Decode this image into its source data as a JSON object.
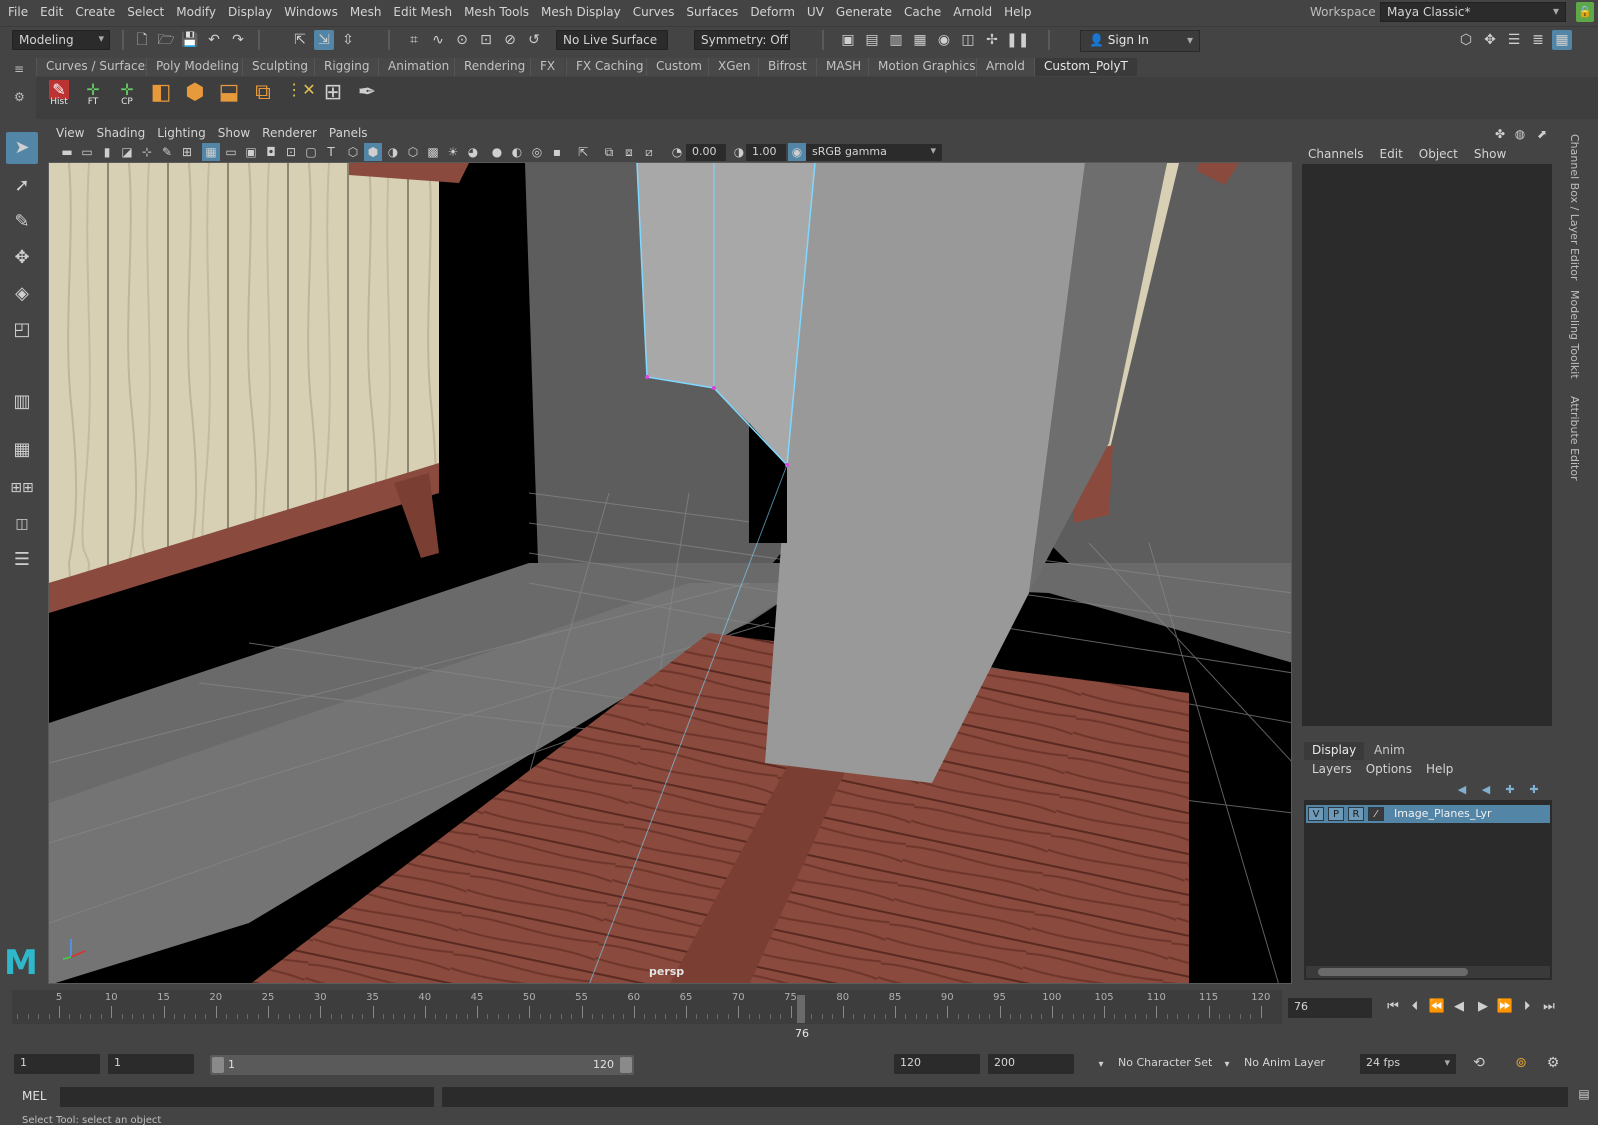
{
  "menu": [
    "File",
    "Edit",
    "Create",
    "Select",
    "Modify",
    "Display",
    "Windows",
    "Mesh",
    "Edit Mesh",
    "Mesh Tools",
    "Mesh Display",
    "Curves",
    "Surfaces",
    "Deform",
    "UV",
    "Generate",
    "Cache",
    "Arnold",
    "Help"
  ],
  "workspace": {
    "label": "Workspace :",
    "value": "Maya Classic*"
  },
  "status": {
    "menuset": "Modeling",
    "live_surface": "No Live Surface",
    "symmetry": "Symmetry: Off",
    "signin": "Sign In"
  },
  "shelf": {
    "tabs": [
      "Curves / Surfaces",
      "Poly Modeling",
      "Sculpting",
      "Rigging",
      "Animation",
      "Rendering",
      "FX",
      "FX Caching",
      "Custom",
      "XGen",
      "Bifrost",
      "MASH",
      "Motion Graphics",
      "Arnold",
      "Custom_PolyT"
    ],
    "active_tab": "Custom_PolyT",
    "buttons": [
      {
        "icon": "history-icon",
        "label": "Hist"
      },
      {
        "icon": "freeze-transform-icon",
        "label": "FT"
      },
      {
        "icon": "center-pivot-icon",
        "label": "CP"
      },
      {
        "icon": "cube-split-icon",
        "label": ""
      },
      {
        "icon": "cube-icon",
        "label": ""
      },
      {
        "icon": "extrude-icon",
        "label": ""
      },
      {
        "icon": "combine-icon",
        "label": ""
      },
      {
        "icon": "delete-vertex-icon",
        "label": ""
      },
      {
        "icon": "grid-icon",
        "label": ""
      },
      {
        "icon": "pen-icon",
        "label": ""
      }
    ]
  },
  "viewport": {
    "menu": [
      "View",
      "Shading",
      "Lighting",
      "Show",
      "Renderer",
      "Panels"
    ],
    "exposure": "0.00",
    "gamma": "1.00",
    "color_space": "sRGB gamma",
    "camera": "persp"
  },
  "channel_box": {
    "menu": [
      "Channels",
      "Edit",
      "Object",
      "Show"
    ]
  },
  "side_tabs": [
    "Channel Box / Layer Editor",
    "Modeling Toolkit",
    "Attribute Editor"
  ],
  "layer_editor": {
    "tabs": [
      "Display",
      "Anim"
    ],
    "active_tab": "Display",
    "menu": [
      "Layers",
      "Options",
      "Help"
    ],
    "layers": [
      {
        "v": "V",
        "p": "P",
        "r": "R",
        "name": "Image_Planes_Lyr"
      }
    ]
  },
  "timeline": {
    "labels": [
      "5",
      "10",
      "15",
      "20",
      "25",
      "30",
      "35",
      "40",
      "45",
      "50",
      "55",
      "60",
      "65",
      "70",
      "75",
      "80",
      "85",
      "90",
      "95",
      "100",
      "105",
      "110",
      "115",
      "120"
    ],
    "current_frame": "76",
    "current_field": "76"
  },
  "range": {
    "start": "1",
    "playback_start": "1",
    "range_start": "1",
    "range_end": "120",
    "playback_end": "120",
    "end": "200",
    "character_set": "No Character Set",
    "anim_layer": "No Anim Layer",
    "fps": "24 fps"
  },
  "command": {
    "label": "MEL",
    "help": "Select Tool: select an object"
  },
  "colors": {
    "accent": "#5285a6",
    "grid": "#606060",
    "wood": "#8a4a3e",
    "plank": "#d8d0b5"
  }
}
